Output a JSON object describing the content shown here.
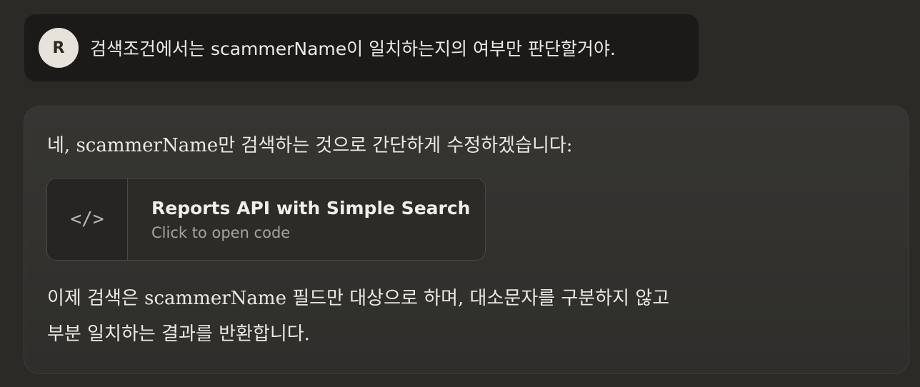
{
  "user_message": {
    "avatar_initial": "R",
    "text": "검색조건에서는 scammerName이 일치하는지의 여부만 판단할거야."
  },
  "assistant_message": {
    "intro": "네, scammerName만 검색하는 것으로 간단하게 수정하겠습니다:",
    "artifact": {
      "icon": "code-icon",
      "icon_glyph": "</>",
      "title": "Reports API with Simple Search",
      "subtitle": "Click to open code"
    },
    "outro_lines": [
      "이제 검색은 scammerName 필드만 대상으로 하며, 대소문자를 구분하지 않고",
      "부분 일치하는 결과를 반환합니다."
    ]
  }
}
